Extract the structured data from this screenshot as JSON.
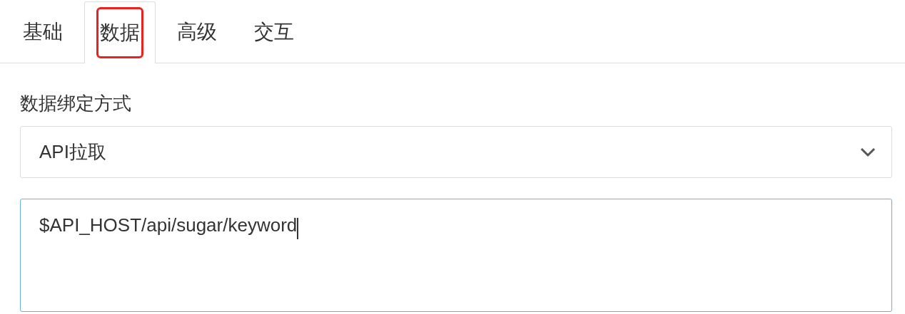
{
  "tabs": [
    {
      "label": "基础",
      "selected": false,
      "highlighted": false
    },
    {
      "label": "数据",
      "selected": true,
      "highlighted": true
    },
    {
      "label": "高级",
      "selected": false,
      "highlighted": false
    },
    {
      "label": "交互",
      "selected": false,
      "highlighted": false
    }
  ],
  "binding": {
    "label": "数据绑定方式",
    "select_value": "API拉取"
  },
  "url_field": {
    "value": "$API_HOST/api/sugar/keyword",
    "focused": true
  }
}
